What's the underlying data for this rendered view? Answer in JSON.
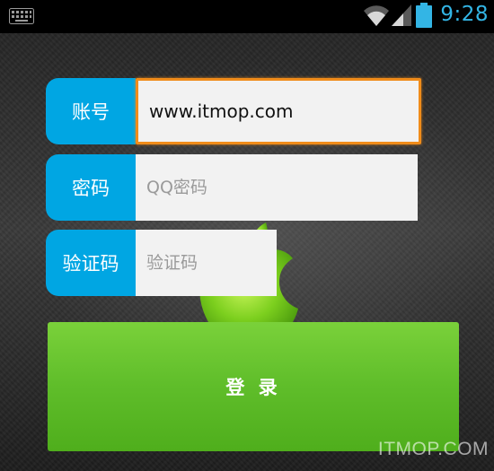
{
  "status_bar": {
    "time": "9:28",
    "icons": [
      "keyboard-icon",
      "wifi-icon",
      "signal-icon",
      "battery-icon"
    ],
    "accent_color": "#33b5e5"
  },
  "form": {
    "account": {
      "label": "账号",
      "value": "www.itmop.com",
      "placeholder": ""
    },
    "password": {
      "label": "密码",
      "value": "",
      "placeholder": "QQ密码"
    },
    "captcha": {
      "label": "验证码",
      "value": "",
      "placeholder": "验证码"
    }
  },
  "login_button": {
    "label": "登 录",
    "color": "#5fbd2a"
  },
  "watermark": "ITMOP.COM",
  "colors": {
    "label_bg": "#00a6e3",
    "focus_border": "#f08c1a",
    "input_bg": "#f2f2f2"
  }
}
